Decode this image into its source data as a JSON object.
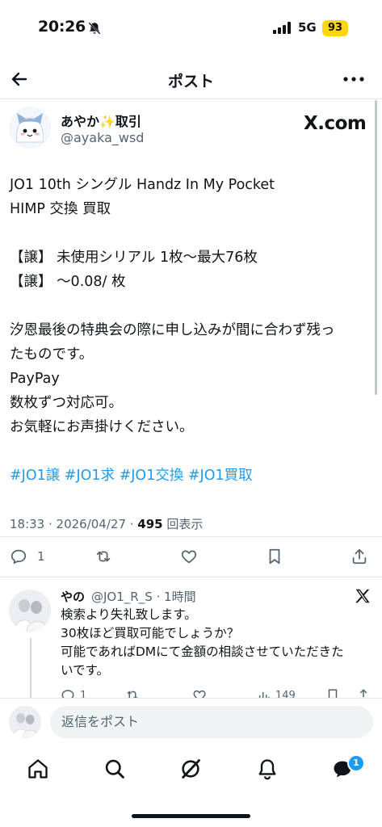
{
  "status": {
    "time": "20:26",
    "network": "5G",
    "battery": "93"
  },
  "nav": {
    "title": "ポスト"
  },
  "author": {
    "name": "あやか✨取引",
    "handle": "@ayaka_wsd"
  },
  "watermark": "X.com",
  "tweet": {
    "lines": [
      "JO1 10th シングル Handz In My Pocket",
      "HIMP 交換 買取",
      "",
      "【譲】 未使用シリアル 1枚〜最大76枚",
      "【譲】 〜0.08/ 枚",
      "",
      "汐恩最後の特典会の際に申し込みが間に合わず残っ",
      "たものです。",
      "PayPay",
      "数枚ずつ対応可。",
      "お気軽にお声掛けください。",
      ""
    ],
    "hashtags": "#JO1譲 #JO1求 #JO1交換 #JO1買取",
    "meta_prefix": "18:33 · 2026/04/27 · ",
    "views": "495",
    "views_suffix": " 回表示"
  },
  "actions": {
    "reply_count": "1"
  },
  "reply": {
    "name": "やの",
    "meta": "@JO1_R_S · 1時間",
    "lines": [
      "検索より失礼致します。",
      "30枚ほど買取可能でしょうか？",
      "可能であればDMにて金額の相談させていただきた",
      "いです。"
    ],
    "reply_count": "1",
    "views": "149"
  },
  "compose": {
    "placeholder": "返信をポスト"
  },
  "tabs": {
    "messages_badge": "1"
  },
  "colors": {
    "accent": "#1d9bf0",
    "battery": "#ffd60a",
    "secondary_text": "#536471"
  }
}
